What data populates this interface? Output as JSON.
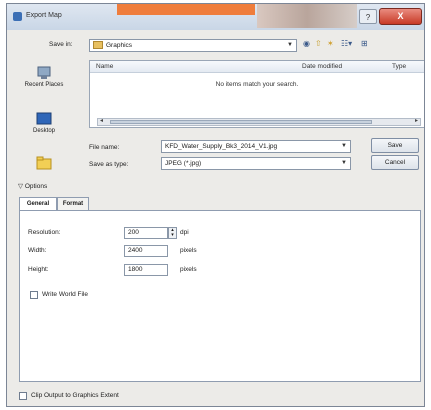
{
  "window": {
    "title": "Export Map",
    "help": "?",
    "close": "X"
  },
  "toolbar": {
    "save_in_label": "Save in:",
    "folder": "Graphics",
    "icons": [
      "globe-icon",
      "up-folder-icon",
      "new-folder-icon",
      "view-menu-icon",
      "connect-folder-icon"
    ]
  },
  "places": [
    {
      "label": "Recent Places",
      "icon": "recent-places-icon"
    },
    {
      "label": "Desktop",
      "icon": "desktop-icon"
    },
    {
      "label": "",
      "icon": "folder-icon"
    }
  ],
  "file_list": {
    "columns": [
      "Name",
      "Date modified",
      "Type"
    ],
    "empty_message": "No items match your search."
  },
  "file_name": {
    "label": "File name:",
    "value": "KFD_Water_Supply_Bk3_2014_V1.jpg"
  },
  "save_as_type": {
    "label": "Save as type:",
    "value": "JPEG (*.jpg)"
  },
  "buttons": {
    "save": "Save",
    "cancel": "Cancel"
  },
  "options": {
    "header": "Options",
    "tabs": [
      "General",
      "Format"
    ],
    "active_tab": "General",
    "resolution": {
      "label": "Resolution:",
      "value": "200",
      "unit": "dpi"
    },
    "width": {
      "label": "Width:",
      "value": "2400",
      "unit": "pixels"
    },
    "height": {
      "label": "Height:",
      "value": "1800",
      "unit": "pixels"
    },
    "write_world_file": "Write World File"
  },
  "clip_output": "Clip Output to Graphics Extent",
  "colors": {
    "accent_orange": "#ef7d3c",
    "close_red": "#c83a26",
    "dialog_bg": "#ecebe8"
  }
}
